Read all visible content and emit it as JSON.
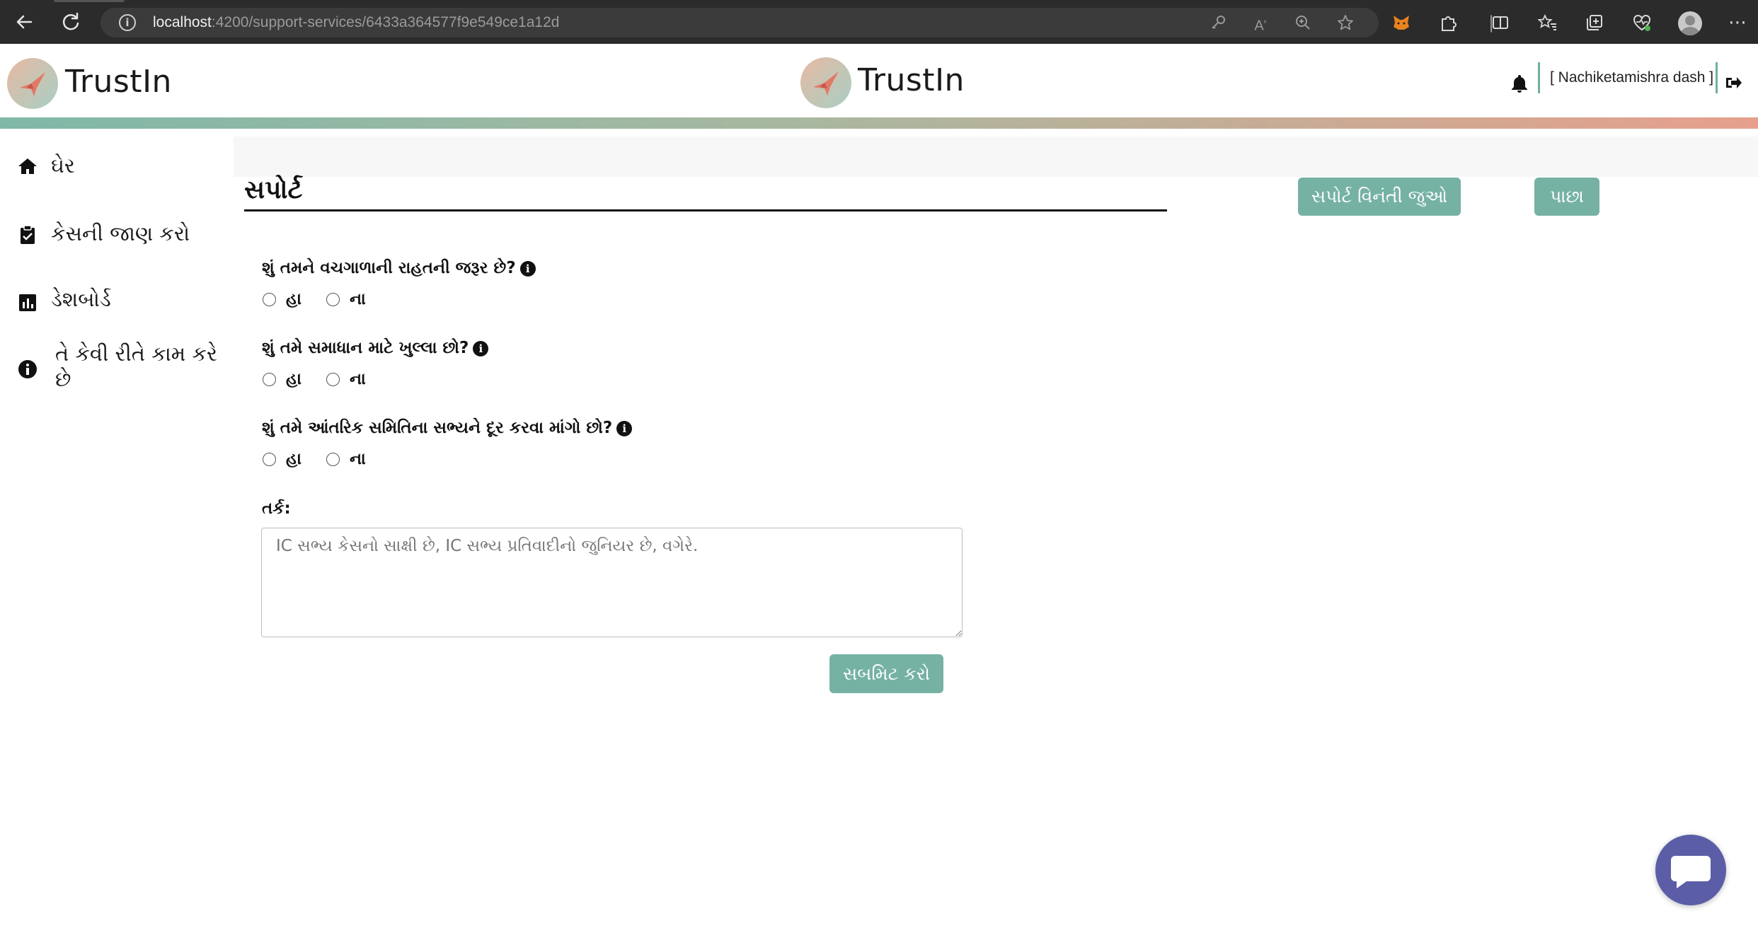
{
  "browser": {
    "url_host": "localhost",
    "url_path": ":4200/support-services/6433a364577f9e549ce1a12d"
  },
  "header": {
    "brand_left": "TrustIn",
    "brand_center": "TrustIn",
    "user_name": "[ Nachiketamishra dash ]"
  },
  "sidebar": {
    "items": [
      {
        "label": "ઘેર",
        "icon": "home-icon"
      },
      {
        "label": "કેસની જાણ કરો",
        "icon": "clipboard-check-icon"
      },
      {
        "label": "ડેશબોર્ડ",
        "icon": "chart-icon"
      },
      {
        "label": "તે કેવી રીતે કામ કરે છે",
        "icon": "info-icon"
      }
    ]
  },
  "main": {
    "title": "સપોર્ટ",
    "view_requests_button": "સપોર્ટ વિનંતી જુઓ",
    "back_button": "પાછા",
    "questions": [
      {
        "text": "શું તમને વચગાળાની રાહતની જરૂર છે?",
        "yes": "હા",
        "no": "ના"
      },
      {
        "text": "શું તમે સમાધાન માટે ખુલ્લા છો?",
        "yes": "હા",
        "no": "ના"
      },
      {
        "text": "શું તમે આંતરિક સમિતિના સભ્યને દૂર કરવા માંગો છો?",
        "yes": "હા",
        "no": "ના"
      }
    ],
    "reason_label": "તર્ક:",
    "reason_placeholder": "IC સભ્ય કેસનો સાક્ષી છે, IC સભ્ય પ્રતિવાદીનો જુનિયર છે, વગેરે.",
    "submit_button": "સબમિટ કરો"
  }
}
